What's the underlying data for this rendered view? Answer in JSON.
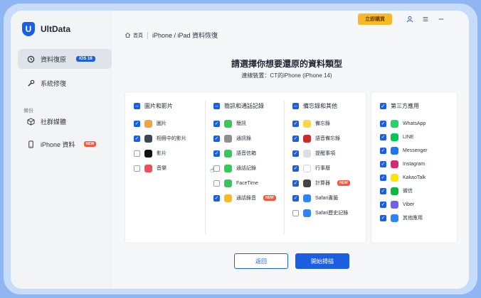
{
  "app": {
    "name": "UltData"
  },
  "sidebar": {
    "items": [
      {
        "label": "資料復原",
        "badge": "iOS 18"
      },
      {
        "label": "系統修復"
      },
      {
        "label": "社群媒體"
      },
      {
        "label": "iPhone 資料",
        "badge": "NEW"
      }
    ],
    "section_label": "備份"
  },
  "topbar": {
    "buy_label": "立即購買"
  },
  "breadcrumb": {
    "home": "首頁",
    "title": "iPhone / iPad 資料恢復"
  },
  "heading": "請選擇你想要還原的資料類型",
  "device_label": "連線裝置：",
  "device_name": "CT的iPhone (iPhone 14)",
  "columns": [
    {
      "title": "圖片和影片",
      "items": [
        {
          "label": "圖片",
          "checked": true,
          "icon": "photos-icon",
          "color": "#f4a23b"
        },
        {
          "label": "相冊中的影片",
          "checked": true,
          "icon": "clapper-icon",
          "color": "#3d4654"
        },
        {
          "label": "影片",
          "checked": false,
          "icon": "appletv-icon",
          "color": "#111111"
        },
        {
          "label": "音樂",
          "checked": false,
          "icon": "music-icon",
          "color": "#f24b5a"
        }
      ]
    },
    {
      "title": "簡訊和通話記錄",
      "items": [
        {
          "label": "簡訊",
          "checked": true,
          "icon": "messages-icon",
          "color": "#34c759"
        },
        {
          "label": "通訊錄",
          "checked": true,
          "icon": "contacts-icon",
          "color": "#8e8e93"
        },
        {
          "label": "語音信箱",
          "checked": true,
          "icon": "voicemail-icon",
          "color": "#34c759"
        },
        {
          "label": "通話記錄",
          "checked": false,
          "icon": "phone-icon",
          "color": "#34c759"
        },
        {
          "label": "FaceTime",
          "checked": false,
          "icon": "facetime-icon",
          "color": "#34c759"
        },
        {
          "label": "通話錄音",
          "checked": true,
          "icon": "recording-icon",
          "color": "#f7b928",
          "badge": "NEW"
        }
      ]
    },
    {
      "title": "備忘錄和其他",
      "items": [
        {
          "label": "備忘錄",
          "checked": true,
          "icon": "notes-icon",
          "color": "#f7d84a"
        },
        {
          "label": "語音備忘錄",
          "checked": true,
          "icon": "voice-memo-icon",
          "color": "#c92a2a"
        },
        {
          "label": "提醒事項",
          "checked": true,
          "icon": "reminders-icon",
          "color": "#dadde2"
        },
        {
          "label": "行事曆",
          "checked": true,
          "icon": "calendar-icon",
          "color": "#ffffff"
        },
        {
          "label": "計算器",
          "checked": true,
          "icon": "calculator-icon",
          "color": "#444444",
          "badge": "NEW"
        },
        {
          "label": "Safari書籤",
          "checked": true,
          "icon": "safari-icon",
          "color": "#2e86f2"
        },
        {
          "label": "Safari歷史記錄",
          "checked": false,
          "icon": "safari-icon",
          "color": "#2e86f2"
        }
      ]
    },
    {
      "title": "第三方應用",
      "items": [
        {
          "label": "WhatsApp",
          "checked": true,
          "icon": "whatsapp-icon",
          "color": "#25d366"
        },
        {
          "label": "LINE",
          "checked": true,
          "icon": "line-icon",
          "color": "#06c755"
        },
        {
          "label": "Messenger",
          "checked": true,
          "icon": "messenger-icon",
          "color": "#1877f2"
        },
        {
          "label": "Instagram",
          "checked": true,
          "icon": "instagram-icon",
          "color": "#d62976"
        },
        {
          "label": "KakaoTalk",
          "checked": true,
          "icon": "kakaotalk-icon",
          "color": "#fee500"
        },
        {
          "label": "微信",
          "checked": true,
          "icon": "wechat-icon",
          "color": "#09b83e"
        },
        {
          "label": "Viber",
          "checked": true,
          "icon": "viber-icon",
          "color": "#7360f2"
        },
        {
          "label": "其他應用",
          "checked": true,
          "icon": "apps-icon",
          "color": "#2e86f2"
        }
      ]
    }
  ],
  "buttons": {
    "back": "返回",
    "scan": "開始掃描"
  }
}
